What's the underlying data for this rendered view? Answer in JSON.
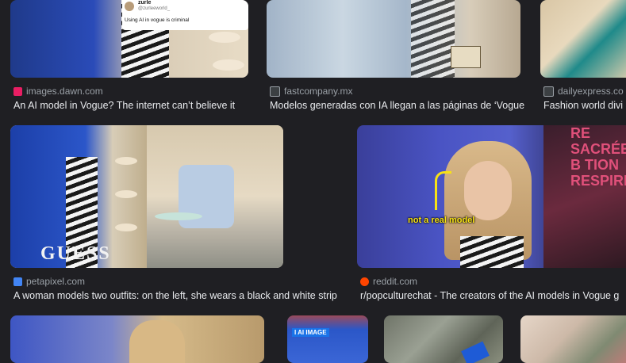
{
  "results": [
    {
      "source": "images.dawn.com",
      "title": "An AI model in Vogue? The internet can’t believe it",
      "favicon_color": "#e91e63"
    },
    {
      "source": "fastcompany.mx",
      "title": "Modelos generadas con IA llegan a las páginas de ‘Vogue",
      "favicon_color": "#3c4043"
    },
    {
      "source": "dailyexpress.co",
      "title": "Fashion world divi",
      "favicon_color": "#3c4043"
    },
    {
      "source": "petapixel.com",
      "title": "A woman models two outfits: on the left, she wears a black and white strip",
      "favicon_color": "#4285f4"
    },
    {
      "source": "reddit.com",
      "title": "r/popculturechat - The creators of the AI models in Vogue g",
      "favicon_color": "#ff4500"
    }
  ],
  "tweet": {
    "name": "zurle",
    "handle": "@zurleeworld_",
    "text": "Using AI in vogue is criminal"
  },
  "image_text": {
    "annotation": "not a real model",
    "brand": "GUESS",
    "ai_tag": "I AI IMAGE",
    "overlay_partial": "RE SACRÉE B TION RESPIREZ"
  }
}
